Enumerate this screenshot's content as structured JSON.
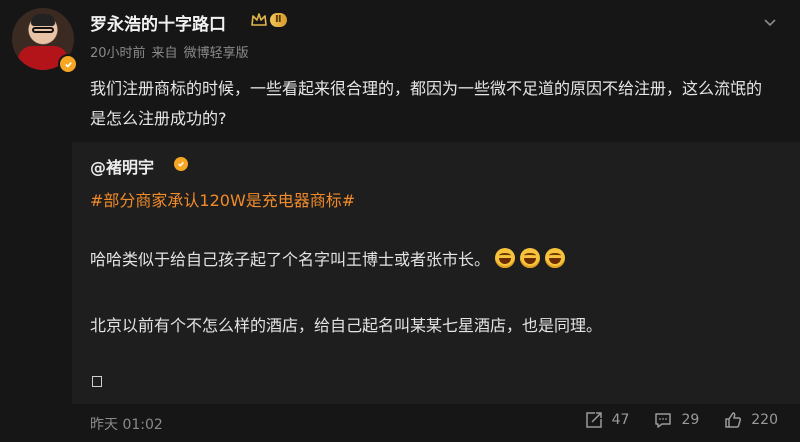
{
  "post": {
    "author": "罗永浩的十字路口",
    "level": "Ⅱ",
    "meta": {
      "time": "20小时前",
      "from_label": "来自",
      "source": "微博轻享版"
    },
    "text": "我们注册商标的时候，一些看起来很合理的，都因为一些微不足道的原因不给注册，这么流氓的是怎么注册成功的?"
  },
  "repost": {
    "author": "@褚明宇",
    "hashtag": "#部分商家承认120W是充电器商标#",
    "line1": "哈哈类似于给自己孩子起了个名字叫王博士或者张市长。",
    "line2": "北京以前有个不怎么样的酒店，给自己起名叫某某七星酒店，也是同理。",
    "emoji_count": 3
  },
  "footer": {
    "time": "昨天 01:02",
    "reposts": "47",
    "comments": "29",
    "likes": "220"
  },
  "colors": {
    "accent": "#f08a2a",
    "background": "#161616",
    "verified": "#f5a623"
  },
  "icons": [
    "chevron-down-icon",
    "crown-icon",
    "verified-icon",
    "repost-icon",
    "comment-icon",
    "like-icon"
  ]
}
